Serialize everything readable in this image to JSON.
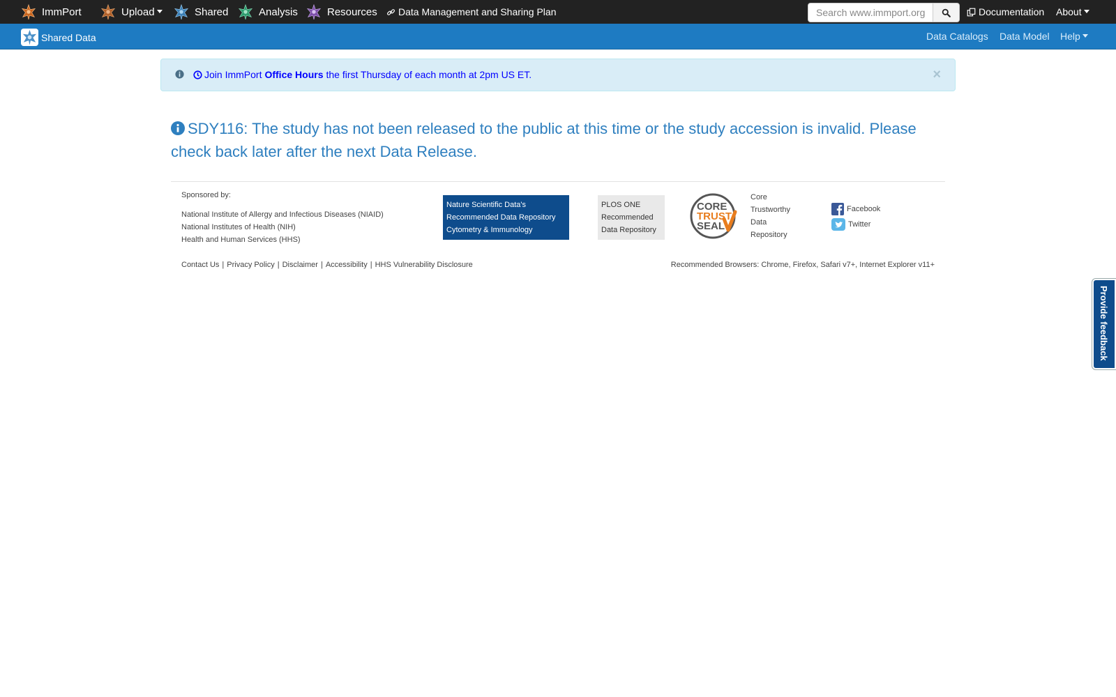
{
  "topnav": {
    "brand": "ImmPort",
    "upload": "Upload",
    "shared": "Shared",
    "analysis": "Analysis",
    "resources": "Resources",
    "dmsp": "Data Management and Sharing Plan",
    "search_placeholder": "Search www.immport.org",
    "documentation": "Documentation",
    "about": "About"
  },
  "subnav": {
    "brand": "Shared Data",
    "data_catalogs": "Data Catalogs",
    "data_model": "Data Model",
    "help": "Help"
  },
  "alert": {
    "prefix": "Join ImmPort",
    "bold": "Office Hours",
    "suffix": "the first Thursday of each month at 2pm US ET."
  },
  "message": "SDY116: The study has not been released to the public at this time or the study accession is invalid. Please check back later after the next Data Release.",
  "footer": {
    "sponsored_by": "Sponsored by:",
    "sponsors": [
      "National Institute of Allergy and Infectious Diseases (NIAID)",
      "National Institutes of Health (NIH)",
      "Health and Human Services (HHS)"
    ],
    "nature": [
      "Nature Scientific Data's",
      "Recommended Data Repository",
      "Cytometry & Immunology"
    ],
    "plos": [
      "PLOS ONE",
      "Recommended",
      "Data Repository"
    ],
    "core_trust_logo": [
      "CORE",
      "TRUST",
      "SEAL"
    ],
    "core_trust": [
      "Core",
      "Trustworthy",
      "Data",
      "Repository"
    ],
    "facebook": "Facebook",
    "twitter": "Twitter",
    "links": [
      "Contact Us",
      "Privacy Policy",
      "Disclaimer",
      "Accessibility",
      "HHS Vulnerability Disclosure"
    ],
    "browsers": "Recommended Browsers: Chrome, Firefox, Safari v7+, Internet Explorer v11+"
  },
  "feedback": "Provide feedback",
  "colors": {
    "navbar": "#222222",
    "subnav": "#1e7bc2",
    "alert_bg": "#d9edf7",
    "message": "#2e7fbf",
    "nature_bg": "#0e4c8c",
    "star_immport": "#c8641e",
    "star_shared": "#3b7fb6",
    "star_analysis": "#2d9a6e",
    "star_resources": "#7b4ea8"
  }
}
